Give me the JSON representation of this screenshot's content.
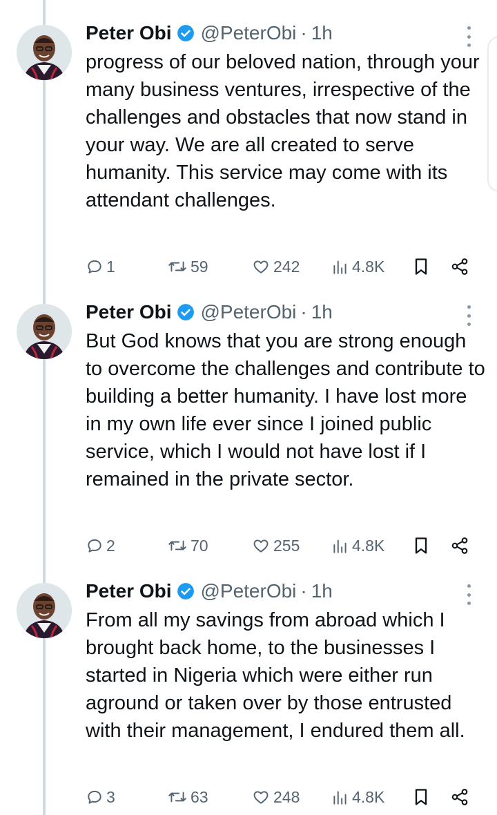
{
  "tweets": [
    {
      "author": {
        "name": "Peter Obi",
        "handle": "@PeterObi",
        "separator": "·",
        "time": "1h"
      },
      "text": "progress of our beloved nation, through your many business ventures, irrespective of the challenges and obstacles that now stand in your way. We are all created to serve humanity. This service may come with its attendant challenges.",
      "stats": {
        "replies": "1",
        "reposts": "59",
        "likes": "242",
        "views": "4.8K"
      }
    },
    {
      "author": {
        "name": "Peter Obi",
        "handle": "@PeterObi",
        "separator": "·",
        "time": "1h"
      },
      "text": "But God knows that you are strong enough to overcome the challenges and contribute to building a better humanity. I have lost more in my own life ever since I joined public service, which I would not have lost if I remained in the private sector.",
      "stats": {
        "replies": "2",
        "reposts": "70",
        "likes": "255",
        "views": "4.8K"
      }
    },
    {
      "author": {
        "name": "Peter Obi",
        "handle": "@PeterObi",
        "separator": "·",
        "time": "1h"
      },
      "text": "From all my savings from abroad which I brought back home, to the businesses I started in Nigeria which were either run aground or taken over by those entrusted with their management, I endured them all.",
      "stats": {
        "replies": "3",
        "reposts": "63",
        "likes": "248",
        "views": "4.8K"
      }
    }
  ],
  "icons": {
    "verified": "verified-badge-icon",
    "more": "more-vertical-icon",
    "reply": "reply-icon",
    "repost": "repost-icon",
    "like": "like-icon",
    "views": "views-icon",
    "bookmark": "bookmark-icon",
    "share": "share-icon"
  },
  "colors": {
    "verified": "#1d9bf0",
    "secondary_text": "#536471",
    "thread_line": "#cfd9de"
  }
}
